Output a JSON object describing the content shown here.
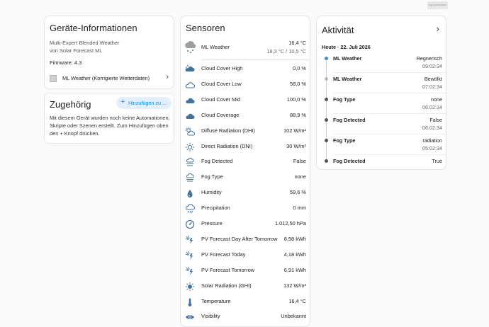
{
  "corner_badge": "logo placeholder",
  "device_info": {
    "title": "Geräte-Informationen",
    "model": "Multi-Expert Blended Weather",
    "manufacturer": "von Solar Forecast ML",
    "firmware": "Firmware: 4.3",
    "link_label": "ML Weather (Korrigierte Wetterdaten)"
  },
  "related": {
    "title": "Zugehörig",
    "add_button": "Hinzufügen zu ...",
    "text": "Mit diesem Gerät wurden noch keine Automationen, Skripte oder Szenen erstellt. Zum Hinzufügen oben den + Knopf drücken."
  },
  "sensors": {
    "title": "Sensoren",
    "primary": {
      "name": "ML Weather",
      "value": "16,4 °C",
      "sub": "18,3 °C / 10,5 °C",
      "icon": "weather-snowy-rainy-icon"
    },
    "items": [
      {
        "name": "Cloud Cover High",
        "value": "0,0 %",
        "icon": "cloud-high-icon"
      },
      {
        "name": "Cloud Cover Low",
        "value": "58,0 %",
        "icon": "cloud-outline-icon"
      },
      {
        "name": "Cloud Cover Mid",
        "value": "100,0 %",
        "icon": "cloud-icon"
      },
      {
        "name": "Cloud Coverage",
        "value": "88,9 %",
        "icon": "cloud-icon"
      },
      {
        "name": "Diffuse Radiation (DHI)",
        "value": "102 W/m²",
        "icon": "sun-cloud-icon"
      },
      {
        "name": "Direct Radiation (DNI)",
        "value": "30 W/m²",
        "icon": "sun-outline-icon"
      },
      {
        "name": "Fog Detected",
        "value": "False",
        "icon": "fog-icon"
      },
      {
        "name": "Fog Type",
        "value": "none",
        "icon": "fog-icon"
      },
      {
        "name": "Humidity",
        "value": "59,6 %",
        "icon": "water-drop-icon"
      },
      {
        "name": "Precipitation",
        "value": "0 mm",
        "icon": "rain-cloud-icon"
      },
      {
        "name": "Pressure",
        "value": "1.012,50 hPa",
        "icon": "gauge-icon"
      },
      {
        "name": "PV Forecast Day After Tomorrow",
        "value": "8,98 kWh",
        "icon": "solar-power-icon"
      },
      {
        "name": "PV Forecast Today",
        "value": "4,18 kWh",
        "icon": "solar-power-icon"
      },
      {
        "name": "PV Forecast Tomorrow",
        "value": "6,91 kWh",
        "icon": "solar-power-icon"
      },
      {
        "name": "Solar Radiation (GHI)",
        "value": "132 W/m²",
        "icon": "sun-icon"
      },
      {
        "name": "Temperature",
        "value": "16,4 °C",
        "icon": "thermometer-icon"
      },
      {
        "name": "Visibility",
        "value": "Unbekannt",
        "icon": "eye-icon"
      }
    ]
  },
  "activity": {
    "title": "Aktivität",
    "date": "Heute · 22. Juli 2026",
    "entries": [
      {
        "name": "ML Weather",
        "state": "Regnerisch",
        "time": "09:02:34",
        "dot": "#3b8fd9"
      },
      {
        "name": "ML Weather",
        "state": "Bewölkt",
        "time": "07:02:34",
        "dot": "#b8b8b8"
      },
      {
        "name": "Fog Type",
        "state": "none",
        "time": "06:02:34",
        "dot": "#555555"
      },
      {
        "name": "Fog Detected",
        "state": "False",
        "time": "06:02:34",
        "dot": "#555555"
      },
      {
        "name": "Fog Type",
        "state": "radiation",
        "time": "05:02:34",
        "dot": "#555555"
      },
      {
        "name": "Fog Detected",
        "state": "True",
        "time": "",
        "dot": "#555555"
      }
    ]
  },
  "colors": {
    "accent": "#44739e",
    "link_blue": "#0d8bd9",
    "button_bg": "#e3f0fb"
  }
}
